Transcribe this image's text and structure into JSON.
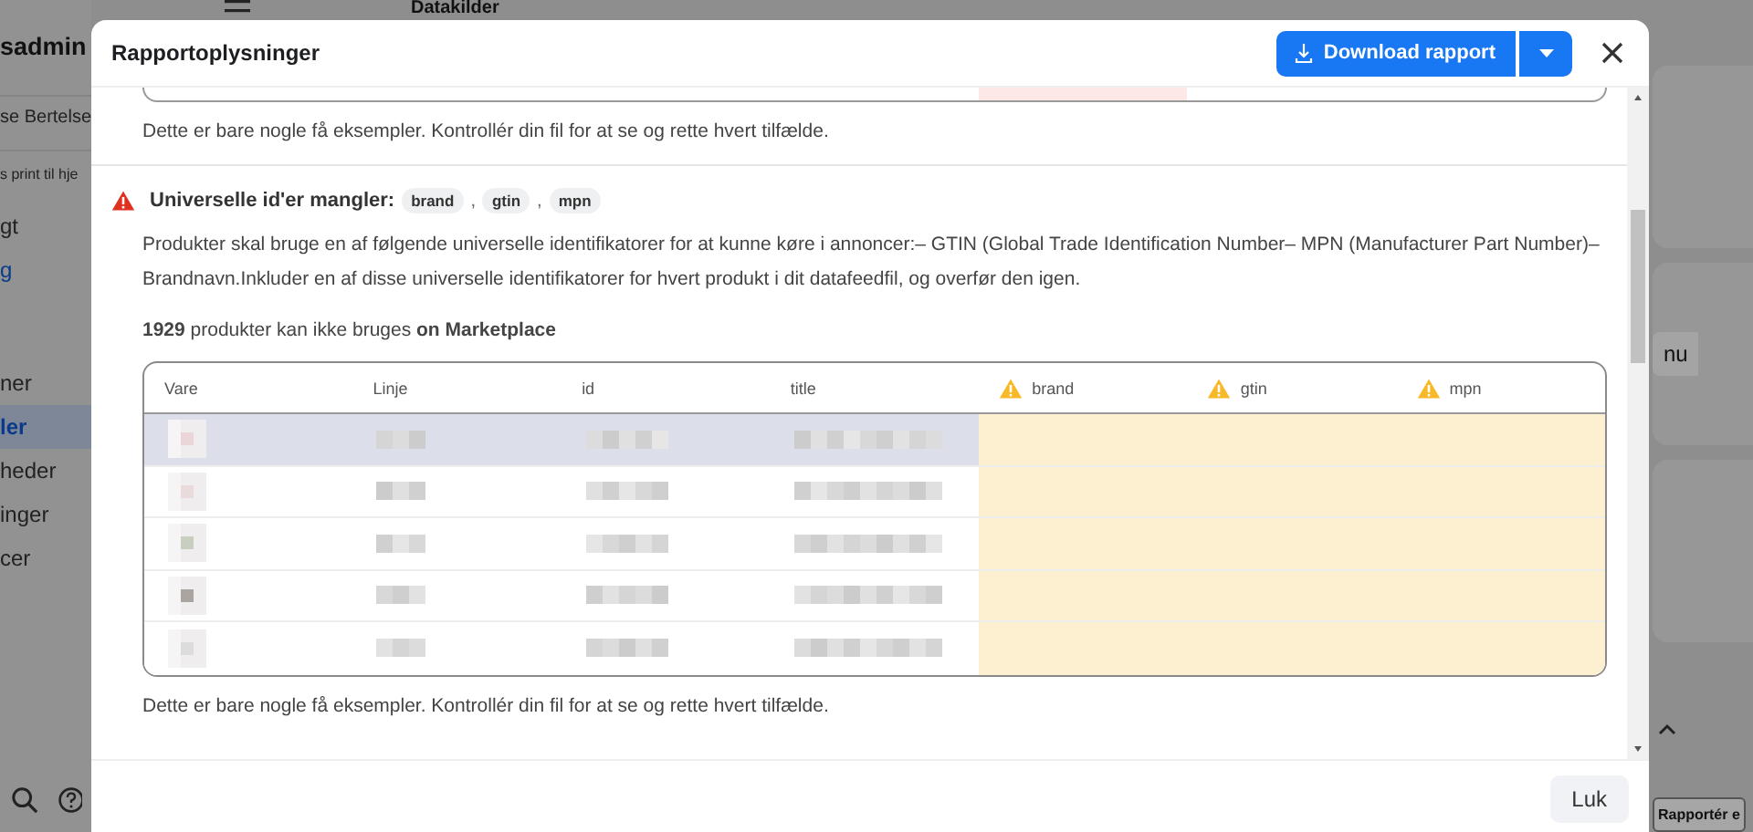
{
  "background": {
    "page_title": "Datakilder",
    "account_name": "sadmin",
    "user_name": "se Bertelse",
    "notice": "s print til hje",
    "nav_items": [
      {
        "label": "gt",
        "kind": "item",
        "selected": false
      },
      {
        "label": "g",
        "kind": "link",
        "selected": false
      },
      {
        "label": "ner",
        "kind": "item",
        "selected": false
      },
      {
        "label": "ler",
        "kind": "item",
        "selected": true
      },
      {
        "label": "heder",
        "kind": "item",
        "selected": false
      },
      {
        "label": "inger",
        "kind": "item",
        "selected": false
      },
      {
        "label": "cer",
        "kind": "item",
        "selected": false
      }
    ],
    "right_button": "nu",
    "report_button": "Rapportér e"
  },
  "dialog": {
    "title": "Rapportoplysninger",
    "download_button": "Download rapport",
    "previous_note": "Dette er bare nogle få eksempler. Kontrollér din fil for at se og rette hvert tilfælde.",
    "section": {
      "title": "Universelle id'er mangler:",
      "fields": [
        "brand",
        "gtin",
        "mpn"
      ],
      "separator": ",",
      "description": "Produkter skal bruge en af følgende universelle identifikatorer for at kunne køre i annoncer:– GTIN (Global Trade Identification Number– MPN (Manufacturer Part Number)– Brandnavn.Inkluder en af disse universelle identifikatorer for hvert produkt i dit datafeedfil, og overfør den igen.",
      "count_text": "**1929** produkter kan ikke bruges **on Marketplace**",
      "table": {
        "columns": [
          {
            "label": "Vare",
            "missing": false
          },
          {
            "label": "Linje",
            "missing": false
          },
          {
            "label": "id",
            "missing": false
          },
          {
            "label": "title",
            "missing": false
          },
          {
            "label": "brand",
            "missing": true
          },
          {
            "label": "gtin",
            "missing": true
          },
          {
            "label": "mpn",
            "missing": true
          }
        ],
        "rows": [
          {
            "hovered": true
          },
          {
            "hovered": false
          },
          {
            "hovered": false
          },
          {
            "hovered": false
          },
          {
            "hovered": false
          }
        ]
      },
      "note": "Dette er bare nogle få eksempler. Kontrollér din fil for at se og rette hvert tilfælde."
    },
    "close_button": "Luk"
  }
}
